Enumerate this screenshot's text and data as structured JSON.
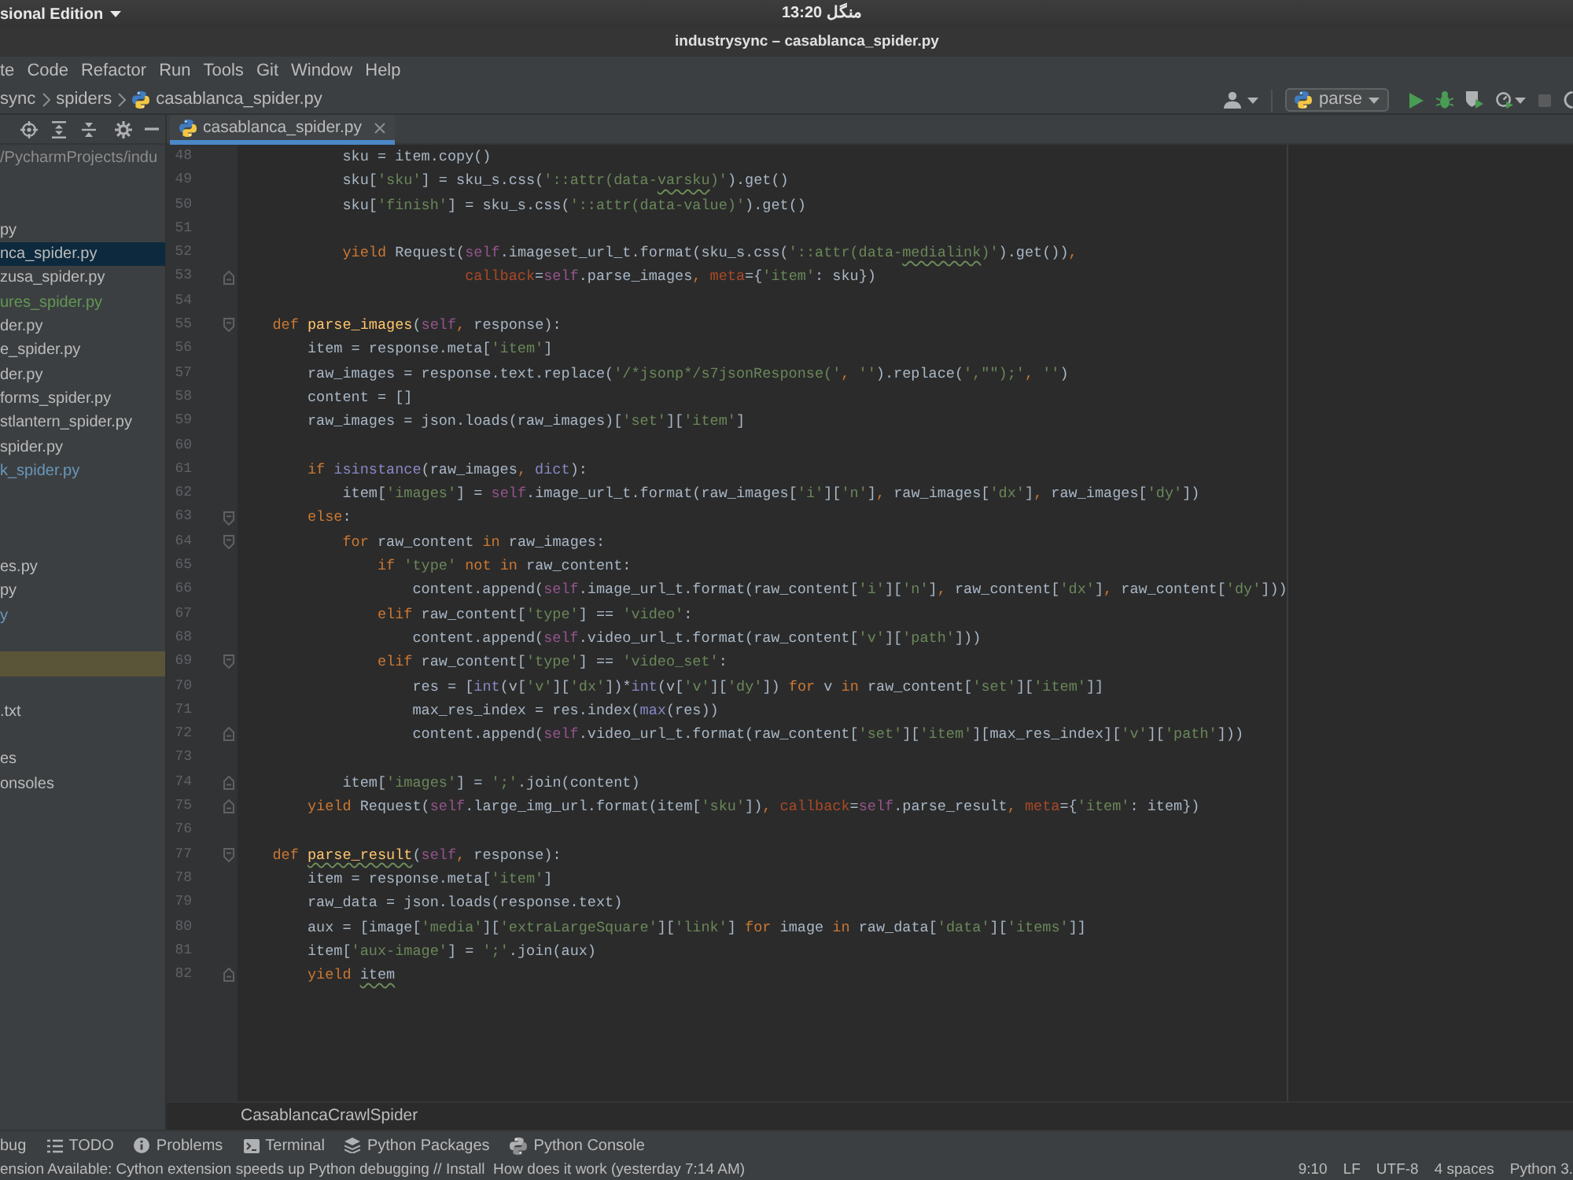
{
  "top_bar": {
    "app_menu": "sional Edition",
    "clock": "13:20 منگل"
  },
  "window": {
    "title": "industrysync – casablanca_spider.py"
  },
  "menu": [
    "te",
    "Code",
    "Refactor",
    "Run",
    "Tools",
    "Git",
    "Window",
    "Help"
  ],
  "navigation_bar": {
    "breadcrumbs": [
      "sync",
      "spiders",
      "casablanca_spider.py"
    ],
    "run_configuration": "parse"
  },
  "project_tree": {
    "rows": [
      {
        "text": "/PycharmProjects/indu",
        "selected": false,
        "highlighted": false,
        "color": "#8c8c8c"
      },
      {
        "selected": false,
        "highlighted": false
      },
      {
        "selected": false,
        "highlighted": false
      },
      {
        "text": "py",
        "selected": false,
        "highlighted": false,
        "color": "#bbbbbb"
      },
      {
        "text": "nca_spider.py",
        "selected": true,
        "highlighted": false,
        "color": "#bbbbbb"
      },
      {
        "text": "zusa_spider.py",
        "selected": false,
        "highlighted": false,
        "color": "#bbbbbb"
      },
      {
        "text": "ures_spider.py",
        "selected": false,
        "highlighted": false,
        "color": "#629755"
      },
      {
        "text": "der.py",
        "selected": false,
        "highlighted": false,
        "color": "#bbbbbb"
      },
      {
        "text": "e_spider.py",
        "selected": false,
        "highlighted": false,
        "color": "#bbbbbb"
      },
      {
        "text": "der.py",
        "selected": false,
        "highlighted": false,
        "color": "#bbbbbb"
      },
      {
        "text": "forms_spider.py",
        "selected": false,
        "highlighted": false,
        "color": "#bbbbbb"
      },
      {
        "text": "stlantern_spider.py",
        "selected": false,
        "highlighted": false,
        "color": "#bbbbbb"
      },
      {
        "text": "spider.py",
        "selected": false,
        "highlighted": false,
        "color": "#bbbbbb"
      },
      {
        "text": "k_spider.py",
        "selected": false,
        "highlighted": false,
        "color": "#6897bb"
      },
      {
        "selected": false,
        "highlighted": false
      },
      {
        "selected": false,
        "highlighted": false
      },
      {
        "selected": false,
        "highlighted": false
      },
      {
        "text": "es.py",
        "selected": false,
        "highlighted": false,
        "color": "#bbbbbb"
      },
      {
        "text": "py",
        "selected": false,
        "highlighted": false,
        "color": "#bbbbbb"
      },
      {
        "text": "y",
        "selected": false,
        "highlighted": false,
        "color": "#6897bb"
      },
      {
        "selected": false,
        "highlighted": false
      },
      {
        "selected": false,
        "highlighted": true
      },
      {
        "selected": false,
        "highlighted": false
      },
      {
        "text": ".txt",
        "selected": false,
        "highlighted": false,
        "color": "#bbbbbb"
      },
      {
        "selected": false,
        "highlighted": false
      },
      {
        "text": "es",
        "selected": false,
        "highlighted": false,
        "color": "#bbbbbb"
      },
      {
        "text": "onsoles",
        "selected": false,
        "highlighted": false,
        "color": "#bbbbbb"
      }
    ]
  },
  "editor": {
    "tabs": [
      {
        "label": "casablanca_spider.py",
        "selected": true
      }
    ],
    "lines": [
      {
        "number": "48",
        "fold_start": false,
        "fold_end": false,
        "tokens": [
          {
            "kind": "plain",
            "text": "            sku = item.copy()"
          }
        ]
      },
      {
        "number": "49",
        "fold_start": false,
        "fold_end": false,
        "tokens": [
          {
            "kind": "plain",
            "text": "            sku["
          },
          {
            "kind": "string",
            "text": "'sku'"
          },
          {
            "kind": "plain",
            "text": "] = sku_s.css("
          },
          {
            "kind": "string",
            "text": "'::attr(data-"
          },
          {
            "kind": "string",
            "text": "varsku",
            "squiggle": true
          },
          {
            "kind": "string",
            "text": ")'"
          },
          {
            "kind": "plain",
            "text": ").get()"
          }
        ]
      },
      {
        "number": "50",
        "fold_start": false,
        "fold_end": false,
        "tokens": [
          {
            "kind": "plain",
            "text": "            sku["
          },
          {
            "kind": "string",
            "text": "'finish'"
          },
          {
            "kind": "plain",
            "text": "] = sku_s.css("
          },
          {
            "kind": "string",
            "text": "'::attr(data-value)'"
          },
          {
            "kind": "plain",
            "text": ").get()"
          }
        ]
      },
      {
        "number": "51",
        "fold_start": false,
        "fold_end": false
      },
      {
        "number": "52",
        "fold_start": false,
        "fold_end": false,
        "tokens": [
          {
            "kind": "keyword",
            "text": "            yield "
          },
          {
            "kind": "plain",
            "text": "Request("
          },
          {
            "kind": "self",
            "text": "self"
          },
          {
            "kind": "plain",
            "text": ".imageset_url_t.format(sku_s.css("
          },
          {
            "kind": "string",
            "text": "'::attr(data-"
          },
          {
            "kind": "string",
            "text": "medialink",
            "squiggle": true
          },
          {
            "kind": "string",
            "text": ")'"
          },
          {
            "kind": "plain",
            "text": ").get())"
          },
          {
            "kind": "separator",
            "text": ","
          }
        ]
      },
      {
        "number": "53",
        "fold_start": false,
        "fold_end": true,
        "tokens": [
          {
            "kind": "kwarg",
            "text": "                          callback"
          },
          {
            "kind": "plain",
            "text": "="
          },
          {
            "kind": "self",
            "text": "self"
          },
          {
            "kind": "plain",
            "text": ".parse_images"
          },
          {
            "kind": "separator",
            "text": ","
          },
          {
            "kind": "kwarg",
            "text": " meta"
          },
          {
            "kind": "plain",
            "text": "={"
          },
          {
            "kind": "string",
            "text": "'item'"
          },
          {
            "kind": "plain",
            "text": ": sku})"
          }
        ]
      },
      {
        "number": "54",
        "fold_start": false,
        "fold_end": false
      },
      {
        "number": "55",
        "fold_start": true,
        "fold_end": false,
        "tokens": [
          {
            "kind": "keyword",
            "text": "    def "
          },
          {
            "kind": "function",
            "text": "parse_images"
          },
          {
            "kind": "plain",
            "text": "("
          },
          {
            "kind": "self",
            "text": "self"
          },
          {
            "kind": "separator",
            "text": ","
          },
          {
            "kind": "plain",
            "text": " response):"
          }
        ]
      },
      {
        "number": "56",
        "fold_start": false,
        "fold_end": false,
        "tokens": [
          {
            "kind": "plain",
            "text": "        item = response.meta["
          },
          {
            "kind": "string",
            "text": "'item'"
          },
          {
            "kind": "plain",
            "text": "]"
          }
        ]
      },
      {
        "number": "57",
        "fold_start": false,
        "fold_end": false,
        "tokens": [
          {
            "kind": "plain",
            "text": "        raw_images = response.text.replace("
          },
          {
            "kind": "string",
            "text": "'/*jsonp*/s7jsonResponse('"
          },
          {
            "kind": "separator",
            "text": ","
          },
          {
            "kind": "string",
            "text": " ''"
          },
          {
            "kind": "plain",
            "text": ").replace("
          },
          {
            "kind": "string",
            "text": "',\"\");'"
          },
          {
            "kind": "separator",
            "text": ","
          },
          {
            "kind": "string",
            "text": " ''"
          },
          {
            "kind": "plain",
            "text": ")"
          }
        ]
      },
      {
        "number": "58",
        "fold_start": false,
        "fold_end": false,
        "tokens": [
          {
            "kind": "plain",
            "text": "        content = []"
          }
        ]
      },
      {
        "number": "59",
        "fold_start": false,
        "fold_end": false,
        "tokens": [
          {
            "kind": "plain",
            "text": "        raw_images = json.loads(raw_images)["
          },
          {
            "kind": "string",
            "text": "'set'"
          },
          {
            "kind": "plain",
            "text": "]["
          },
          {
            "kind": "string",
            "text": "'item'"
          },
          {
            "kind": "plain",
            "text": "]"
          }
        ]
      },
      {
        "number": "60",
        "fold_start": false,
        "fold_end": false
      },
      {
        "number": "61",
        "fold_start": false,
        "fold_end": false,
        "tokens": [
          {
            "kind": "keyword",
            "text": "        if "
          },
          {
            "kind": "builtin",
            "text": "isinstance"
          },
          {
            "kind": "plain",
            "text": "(raw_images"
          },
          {
            "kind": "separator",
            "text": ","
          },
          {
            "kind": "builtin",
            "text": " dict"
          },
          {
            "kind": "plain",
            "text": "):"
          }
        ]
      },
      {
        "number": "62",
        "fold_start": false,
        "fold_end": false,
        "tokens": [
          {
            "kind": "plain",
            "text": "            item["
          },
          {
            "kind": "string",
            "text": "'images'"
          },
          {
            "kind": "plain",
            "text": "] = "
          },
          {
            "kind": "self",
            "text": "self"
          },
          {
            "kind": "plain",
            "text": ".image_url_t.format(raw_images["
          },
          {
            "kind": "string",
            "text": "'i'"
          },
          {
            "kind": "plain",
            "text": "]["
          },
          {
            "kind": "string",
            "text": "'n'"
          },
          {
            "kind": "plain",
            "text": "]"
          },
          {
            "kind": "separator",
            "text": ","
          },
          {
            "kind": "plain",
            "text": " raw_images["
          },
          {
            "kind": "string",
            "text": "'dx'"
          },
          {
            "kind": "plain",
            "text": "]"
          },
          {
            "kind": "separator",
            "text": ","
          },
          {
            "kind": "plain",
            "text": " raw_images["
          },
          {
            "kind": "string",
            "text": "'dy'"
          },
          {
            "kind": "plain",
            "text": "])"
          }
        ]
      },
      {
        "number": "63",
        "fold_start": true,
        "fold_end": false,
        "tokens": [
          {
            "kind": "keyword",
            "text": "        else"
          },
          {
            "kind": "plain",
            "text": ":"
          }
        ]
      },
      {
        "number": "64",
        "fold_start": true,
        "fold_end": false,
        "tokens": [
          {
            "kind": "keyword",
            "text": "            for "
          },
          {
            "kind": "plain",
            "text": "raw_content "
          },
          {
            "kind": "keyword",
            "text": "in "
          },
          {
            "kind": "plain",
            "text": "raw_images:"
          }
        ]
      },
      {
        "number": "65",
        "fold_start": false,
        "fold_end": false,
        "tokens": [
          {
            "kind": "keyword",
            "text": "                if "
          },
          {
            "kind": "string",
            "text": "'type' "
          },
          {
            "kind": "keyword",
            "text": "not in "
          },
          {
            "kind": "plain",
            "text": "raw_content:"
          }
        ]
      },
      {
        "number": "66",
        "fold_start": false,
        "fold_end": false,
        "tokens": [
          {
            "kind": "plain",
            "text": "                    content.append("
          },
          {
            "kind": "self",
            "text": "self"
          },
          {
            "kind": "plain",
            "text": ".image_url_t.format(raw_content["
          },
          {
            "kind": "string",
            "text": "'i'"
          },
          {
            "kind": "plain",
            "text": "]["
          },
          {
            "kind": "string",
            "text": "'n'"
          },
          {
            "kind": "plain",
            "text": "]"
          },
          {
            "kind": "separator",
            "text": ","
          },
          {
            "kind": "plain",
            "text": " raw_content["
          },
          {
            "kind": "string",
            "text": "'dx'"
          },
          {
            "kind": "plain",
            "text": "]"
          },
          {
            "kind": "separator",
            "text": ","
          },
          {
            "kind": "plain",
            "text": " raw_content["
          },
          {
            "kind": "string",
            "text": "'dy'"
          },
          {
            "kind": "plain",
            "text": "]))"
          }
        ]
      },
      {
        "number": "67",
        "fold_start": false,
        "fold_end": false,
        "tokens": [
          {
            "kind": "keyword",
            "text": "                elif "
          },
          {
            "kind": "plain",
            "text": "raw_content["
          },
          {
            "kind": "string",
            "text": "'type'"
          },
          {
            "kind": "plain",
            "text": "] == "
          },
          {
            "kind": "string",
            "text": "'video'"
          },
          {
            "kind": "plain",
            "text": ":"
          }
        ]
      },
      {
        "number": "68",
        "fold_start": false,
        "fold_end": false,
        "tokens": [
          {
            "kind": "plain",
            "text": "                    content.append("
          },
          {
            "kind": "self",
            "text": "self"
          },
          {
            "kind": "plain",
            "text": ".video_url_t.format(raw_content["
          },
          {
            "kind": "string",
            "text": "'v'"
          },
          {
            "kind": "plain",
            "text": "]["
          },
          {
            "kind": "string",
            "text": "'path'"
          },
          {
            "kind": "plain",
            "text": "]))"
          }
        ]
      },
      {
        "number": "69",
        "fold_start": true,
        "fold_end": false,
        "tokens": [
          {
            "kind": "keyword",
            "text": "                elif "
          },
          {
            "kind": "plain",
            "text": "raw_content["
          },
          {
            "kind": "string",
            "text": "'type'"
          },
          {
            "kind": "plain",
            "text": "] == "
          },
          {
            "kind": "string",
            "text": "'video_set'"
          },
          {
            "kind": "plain",
            "text": ":"
          }
        ]
      },
      {
        "number": "70",
        "fold_start": false,
        "fold_end": false,
        "tokens": [
          {
            "kind": "plain",
            "text": "                    res = ["
          },
          {
            "kind": "builtin",
            "text": "int"
          },
          {
            "kind": "plain",
            "text": "(v["
          },
          {
            "kind": "string",
            "text": "'v'"
          },
          {
            "kind": "plain",
            "text": "]["
          },
          {
            "kind": "string",
            "text": "'dx'"
          },
          {
            "kind": "plain",
            "text": "])*"
          },
          {
            "kind": "builtin",
            "text": "int"
          },
          {
            "kind": "plain",
            "text": "(v["
          },
          {
            "kind": "string",
            "text": "'v'"
          },
          {
            "kind": "plain",
            "text": "]["
          },
          {
            "kind": "string",
            "text": "'dy'"
          },
          {
            "kind": "plain",
            "text": "]) "
          },
          {
            "kind": "keyword",
            "text": "for "
          },
          {
            "kind": "plain",
            "text": "v "
          },
          {
            "kind": "keyword",
            "text": "in "
          },
          {
            "kind": "plain",
            "text": "raw_content["
          },
          {
            "kind": "string",
            "text": "'set'"
          },
          {
            "kind": "plain",
            "text": "]["
          },
          {
            "kind": "string",
            "text": "'item'"
          },
          {
            "kind": "plain",
            "text": "]]"
          }
        ]
      },
      {
        "number": "71",
        "fold_start": false,
        "fold_end": false,
        "tokens": [
          {
            "kind": "plain",
            "text": "                    max_res_index = res.index("
          },
          {
            "kind": "builtin",
            "text": "max"
          },
          {
            "kind": "plain",
            "text": "(res))"
          }
        ]
      },
      {
        "number": "72",
        "fold_start": false,
        "fold_end": true,
        "tokens": [
          {
            "kind": "plain",
            "text": "                    content.append("
          },
          {
            "kind": "self",
            "text": "self"
          },
          {
            "kind": "plain",
            "text": ".video_url_t.format(raw_content["
          },
          {
            "kind": "string",
            "text": "'set'"
          },
          {
            "kind": "plain",
            "text": "]["
          },
          {
            "kind": "string",
            "text": "'item'"
          },
          {
            "kind": "plain",
            "text": "][max_res_index]["
          },
          {
            "kind": "string",
            "text": "'v'"
          },
          {
            "kind": "plain",
            "text": "]["
          },
          {
            "kind": "string",
            "text": "'path'"
          },
          {
            "kind": "plain",
            "text": "]))"
          }
        ]
      },
      {
        "number": "73",
        "fold_start": false,
        "fold_end": false
      },
      {
        "number": "74",
        "fold_start": false,
        "fold_end": true,
        "tokens": [
          {
            "kind": "plain",
            "text": "            item["
          },
          {
            "kind": "string",
            "text": "'images'"
          },
          {
            "kind": "plain",
            "text": "] = "
          },
          {
            "kind": "string",
            "text": "';'"
          },
          {
            "kind": "plain",
            "text": ".join(content)"
          }
        ]
      },
      {
        "number": "75",
        "fold_start": false,
        "fold_end": true,
        "tokens": [
          {
            "kind": "keyword",
            "text": "        yield "
          },
          {
            "kind": "plain",
            "text": "Request("
          },
          {
            "kind": "self",
            "text": "self"
          },
          {
            "kind": "plain",
            "text": ".large_img_url.format(item["
          },
          {
            "kind": "string",
            "text": "'sku'"
          },
          {
            "kind": "plain",
            "text": "])"
          },
          {
            "kind": "separator",
            "text": ","
          },
          {
            "kind": "kwarg",
            "text": " callback"
          },
          {
            "kind": "plain",
            "text": "="
          },
          {
            "kind": "self",
            "text": "self"
          },
          {
            "kind": "plain",
            "text": ".parse_result"
          },
          {
            "kind": "separator",
            "text": ","
          },
          {
            "kind": "kwarg",
            "text": " meta"
          },
          {
            "kind": "plain",
            "text": "={"
          },
          {
            "kind": "string",
            "text": "'item'"
          },
          {
            "kind": "plain",
            "text": ": item})"
          }
        ]
      },
      {
        "number": "76",
        "fold_start": false,
        "fold_end": false
      },
      {
        "number": "77",
        "fold_start": true,
        "fold_end": false,
        "tokens": [
          {
            "kind": "keyword",
            "text": "    def "
          },
          {
            "kind": "function",
            "text": "parse_result",
            "squiggle": true
          },
          {
            "kind": "plain",
            "text": "("
          },
          {
            "kind": "self",
            "text": "self"
          },
          {
            "kind": "separator",
            "text": ","
          },
          {
            "kind": "plain",
            "text": " response):"
          }
        ]
      },
      {
        "number": "78",
        "fold_start": false,
        "fold_end": false,
        "tokens": [
          {
            "kind": "plain",
            "text": "        item = response.meta["
          },
          {
            "kind": "string",
            "text": "'item'"
          },
          {
            "kind": "plain",
            "text": "]"
          }
        ]
      },
      {
        "number": "79",
        "fold_start": false,
        "fold_end": false,
        "tokens": [
          {
            "kind": "plain",
            "text": "        raw_data = json.loads(response.text)"
          }
        ]
      },
      {
        "number": "80",
        "fold_start": false,
        "fold_end": false,
        "tokens": [
          {
            "kind": "plain",
            "text": "        aux = [image["
          },
          {
            "kind": "string",
            "text": "'media'"
          },
          {
            "kind": "plain",
            "text": "]["
          },
          {
            "kind": "string",
            "text": "'extraLargeSquare'"
          },
          {
            "kind": "plain",
            "text": "]["
          },
          {
            "kind": "string",
            "text": "'link'"
          },
          {
            "kind": "plain",
            "text": "] "
          },
          {
            "kind": "keyword",
            "text": "for "
          },
          {
            "kind": "plain",
            "text": "image "
          },
          {
            "kind": "keyword",
            "text": "in "
          },
          {
            "kind": "plain",
            "text": "raw_data["
          },
          {
            "kind": "string",
            "text": "'data'"
          },
          {
            "kind": "plain",
            "text": "]["
          },
          {
            "kind": "string",
            "text": "'items'"
          },
          {
            "kind": "plain",
            "text": "]]"
          }
        ]
      },
      {
        "number": "81",
        "fold_start": false,
        "fold_end": false,
        "tokens": [
          {
            "kind": "plain",
            "text": "        item["
          },
          {
            "kind": "string",
            "text": "'aux-image'"
          },
          {
            "kind": "plain",
            "text": "] = "
          },
          {
            "kind": "string",
            "text": "';'"
          },
          {
            "kind": "plain",
            "text": ".join(aux)"
          }
        ]
      },
      {
        "number": "82",
        "fold_start": false,
        "fold_end": true,
        "tokens": [
          {
            "kind": "keyword",
            "text": "        yield "
          },
          {
            "kind": "plain",
            "text": "item",
            "squiggle": true
          }
        ]
      }
    ],
    "breadcrumb": "CasablancaCrawlSpider"
  },
  "tool_window_bar": [
    {
      "kind": "debug",
      "label": "bug"
    },
    {
      "kind": "todo",
      "label": "TODO"
    },
    {
      "kind": "problems",
      "label": "Problems"
    },
    {
      "kind": "terminal",
      "label": "Terminal"
    },
    {
      "kind": "packages",
      "label": "Python Packages"
    },
    {
      "kind": "console",
      "label": "Python Console"
    }
  ],
  "status_bar": {
    "message": "ension Available: Cython extension speeds up Python debugging // Install  How does it work (yesterday 7:14 AM)",
    "items": [
      "9:10",
      "LF",
      "UTF-8",
      "4 spaces",
      "Python 3."
    ]
  }
}
